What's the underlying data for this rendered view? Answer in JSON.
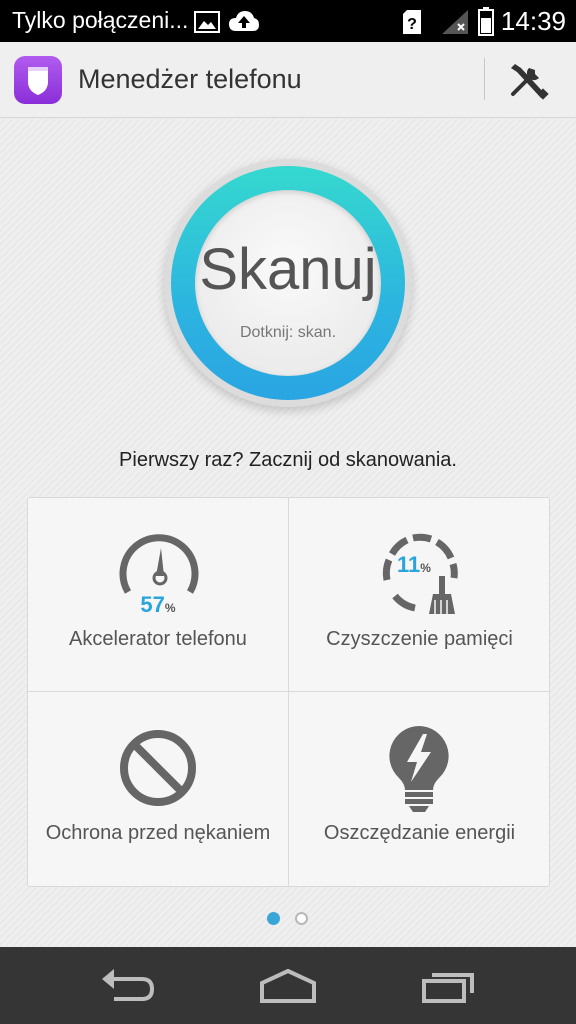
{
  "status_bar": {
    "notification_text": "Tylko połączeni...",
    "icons": [
      "image-icon",
      "cloud-upload-icon",
      "sim-unknown-icon",
      "signal-icon",
      "battery-icon"
    ],
    "time": "14:39"
  },
  "app_bar": {
    "title": "Menedżer telefonu",
    "logo_icon": "shield-icon",
    "tools_icon": "tools-icon"
  },
  "scan": {
    "label": "Skanuj",
    "sub_label": "Dotknij: skan."
  },
  "hint": "Pierwszy raz? Zacznij od skanowania.",
  "tiles": [
    {
      "label": "Akcelerator telefonu",
      "icon": "speedometer-icon",
      "value": "57",
      "unit": "%"
    },
    {
      "label": "Czyszczenie pamięci",
      "icon": "brush-gauge-icon",
      "value": "11",
      "unit": "%"
    },
    {
      "label": "Ochrona przed nękaniem",
      "icon": "block-icon"
    },
    {
      "label": "Oszczędzanie energii",
      "icon": "bulb-lightning-icon"
    }
  ],
  "pager": {
    "count": 2,
    "active": 0
  },
  "colors": {
    "accent": "#2aa5dc",
    "ring_top": "#35d9cf",
    "ring_bottom": "#2aa5e2",
    "logo": "#9b44e4"
  }
}
